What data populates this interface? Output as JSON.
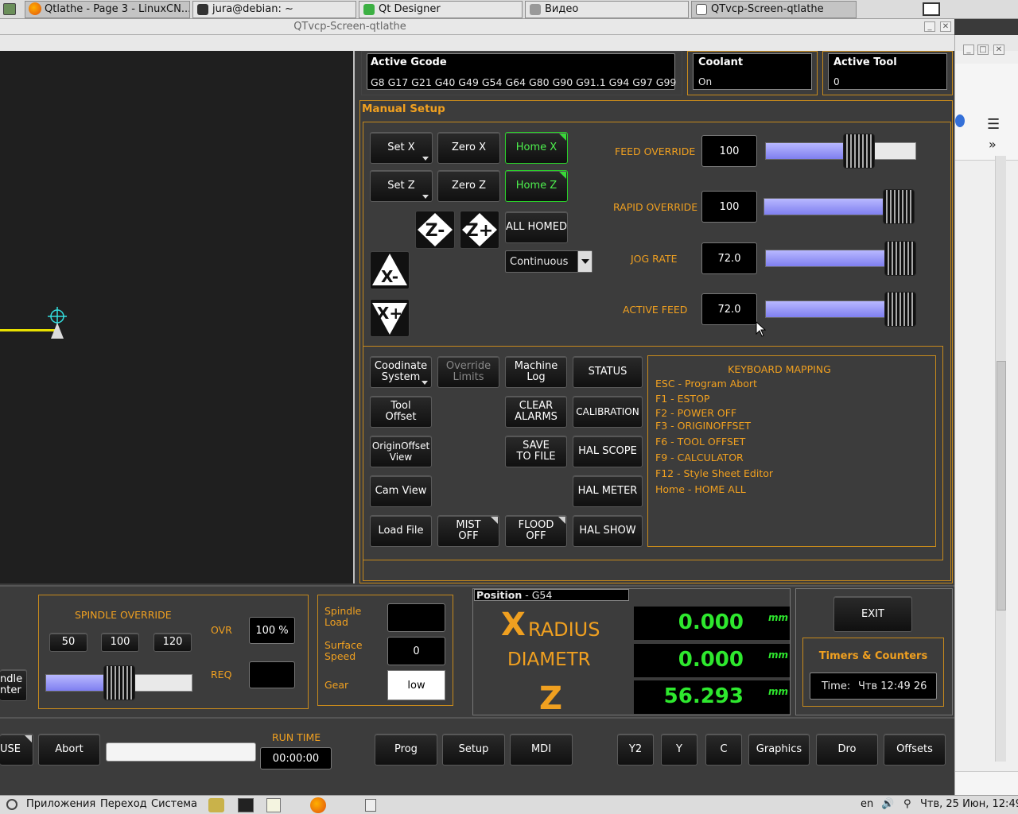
{
  "taskbar": {
    "tasks": [
      {
        "label": "Qtlathe - Page 3 - LinuxCN..."
      },
      {
        "label": "jura@debian: ~"
      },
      {
        "label": "Qt Designer"
      },
      {
        "label": "Видео"
      },
      {
        "label": "QTvcp-Screen-qtlathe"
      }
    ]
  },
  "window": {
    "title": "QTvcp-Screen-qtlathe"
  },
  "status_top": {
    "gcode_title": "Active Gcode",
    "gcode_value": "G8 G17 G21 G40 G49 G54 G64 G80 G90 G91.1 G94 G97 G99",
    "coolant_title": "Coolant",
    "coolant_value": "On",
    "tool_title": "Active Tool",
    "tool_value": "0"
  },
  "manual": {
    "title": "Manual Setup",
    "set_x": "Set X",
    "zero_x": "Zero X",
    "home_x": "Home X",
    "set_z": "Set Z",
    "zero_z": "Zero Z",
    "home_z": "Home Z",
    "all_homed": "ALL HOMED",
    "jog_mode": "Continuous"
  },
  "overrides": {
    "feed_label": "FEED OVERRIDE",
    "feed_value": "100",
    "feed_level": 0.65,
    "rapid_label": "RAPID OVERRIDE",
    "rapid_value": "100",
    "rapid_level": 1.0,
    "jog_label": "JOG RATE",
    "jog_value": "72.0",
    "jog_level": 1.0,
    "active_label": "ACTIVE FEED",
    "active_value": "72.0",
    "active_level": 1.0
  },
  "utilities": {
    "coord": "Coodinate\nSystem",
    "override": "Override\nLimits",
    "mlog": "Machine\nLog",
    "status": "STATUS",
    "tool_offset": "Tool\nOffset",
    "clear": "CLEAR\nALARMS",
    "calib": "CALIBRATION",
    "origin": "OriginOffset\nView",
    "save": "SAVE\nTO FILE",
    "halscope": "HAL SCOPE",
    "camview": "Cam View",
    "halmeter": "HAL METER",
    "load": "Load File",
    "mist": "MIST\nOFF",
    "flood": "FLOOD\nOFF",
    "halshow": "HAL SHOW"
  },
  "keyboard": {
    "title": "KEYBOARD MAPPING",
    "items": [
      "ESC - Program Abort",
      "F1 - ESTOP",
      "F2 - POWER OFF",
      "F3 - ORIGINOFFSET",
      "F6 - TOOL OFFSET",
      "F9 - CALCULATOR",
      "F12 - Style Sheet Editor",
      "Home - HOME ALL"
    ]
  },
  "spindle": {
    "title": "SPINDLE OVERRIDE",
    "b50": "50",
    "b100": "100",
    "b120": "120",
    "ovr_label": "OVR",
    "ovr_value": "100 %",
    "req_label": "REQ",
    "left_btn": "ndle\nnter",
    "load_label": "Spindle\nLoad",
    "surface_label": "Surface\nSpeed",
    "surface_value": "0",
    "gear_label": "Gear",
    "gear_value": "low",
    "level": 0.5
  },
  "position": {
    "title": "Position",
    "sys": " - G54",
    "x_letter": "X",
    "x_mode": "RADIUS",
    "diam": "DIAMETR",
    "z_letter": "Z",
    "x_value": "0.000",
    "d_value": "0.000",
    "z_value": "56.293",
    "unit": "mm"
  },
  "exit_label": "EXIT",
  "timers": {
    "title": "Timers & Counters",
    "time_label": "Time:",
    "time_value": "Чтв 12:49 26"
  },
  "bottom": {
    "pause": "USE",
    "abort": "Abort",
    "runtime_label": "RUN TIME",
    "runtime_value": "00:00:00",
    "tabs": [
      "Prog",
      "Setup",
      "MDI"
    ],
    "right": [
      "Y2",
      "Y",
      "C",
      "Graphics",
      "Dro",
      "Offsets"
    ]
  },
  "desktop": {
    "apps": "Приложения",
    "go": "Переход",
    "sys": "Система",
    "lang": "en",
    "clock": "Чтв, 25 Июн, 12:49"
  }
}
